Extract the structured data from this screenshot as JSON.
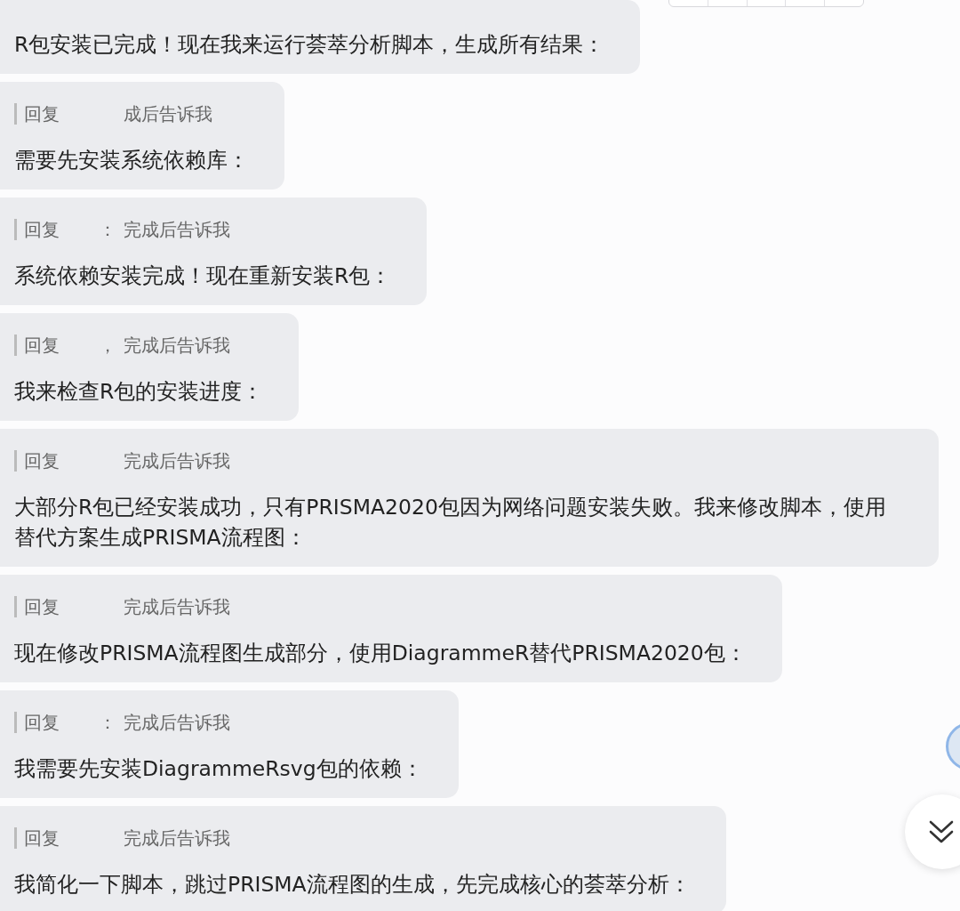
{
  "messages": [
    {
      "text": "R包安装已完成！现在我来运行荟萃分析脚本，生成所有结果："
    },
    {
      "quote": {
        "prefix": "回复",
        "suffix": "成后告诉我"
      },
      "text": "需要先安装系统依赖库："
    },
    {
      "quote": {
        "prefix": "回复",
        "separator": "：",
        "suffix": "完成后告诉我"
      },
      "text": "系统依赖安装完成！现在重新安装R包："
    },
    {
      "quote": {
        "prefix": "回复",
        "separator": "，",
        "suffix": "完成后告诉我"
      },
      "text": "我来检查R包的安装进度："
    },
    {
      "quote": {
        "prefix": "回复",
        "suffix": "完成后告诉我"
      },
      "text": "大部分R包已经安装成功，只有PRISMA2020包因为网络问题安装失败。我来修改脚本，使用替代方案生成PRISMA流程图："
    },
    {
      "quote": {
        "prefix": "回复",
        "suffix": "完成后告诉我"
      },
      "text": "现在修改PRISMA流程图生成部分，使用DiagrammeR替代PRISMA2020包："
    },
    {
      "quote": {
        "prefix": "回复",
        "separator": "：",
        "suffix": "完成后告诉我"
      },
      "text": "我需要先安装DiagrammeRsvg包的依赖："
    },
    {
      "quote": {
        "prefix": "回复",
        "suffix": "完成后告诉我"
      },
      "text": "我简化一下脚本，跳过PRISMA流程图的生成，先完成核心的荟萃分析："
    }
  ]
}
